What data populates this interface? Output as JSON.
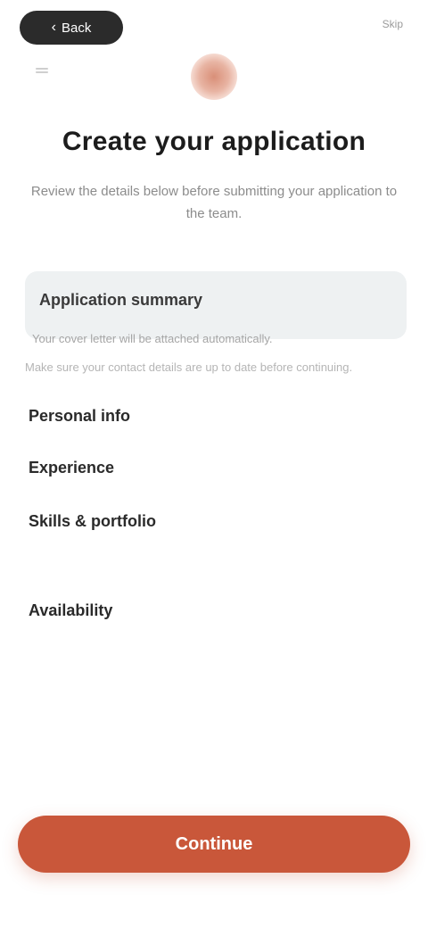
{
  "top": {
    "back_label": "Back",
    "right_label": "Skip"
  },
  "header": {
    "title": "Create your application",
    "subtitle": "Review the details below before submitting your application to the team."
  },
  "cover": {
    "title": "Application summary",
    "note": "Your cover letter will be attached automatically.",
    "extra": "Make sure your contact details are up to date before continuing."
  },
  "details": [
    {
      "label": "Personal info"
    },
    {
      "label": "Experience"
    },
    {
      "label": "Skills & portfolio"
    },
    {
      "label": "Availability"
    }
  ],
  "footer": {
    "continue_label": "Continue"
  },
  "colors": {
    "accent": "#c9573a",
    "card": "#eef1f2",
    "pill": "#2b2b2b"
  }
}
